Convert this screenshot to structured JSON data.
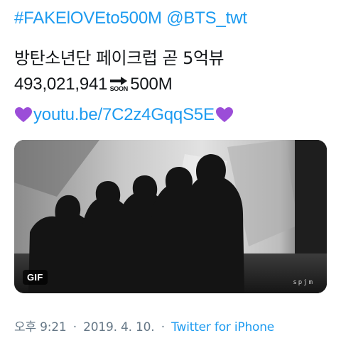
{
  "tweet": {
    "hashtag": "#FAKElOVEto500M",
    "mention": "@BTS_twt",
    "korean_line": "방탄소년단 페이크럽 곧 5억뷰",
    "count_before": "493,021,941",
    "soon_label": "SOON",
    "count_after": "500M",
    "link": "youtu.be/7C2z4GqqS5E",
    "heart_color": "#9b4dd8"
  },
  "media": {
    "badge": "GIF",
    "watermark": "spjm"
  },
  "meta": {
    "time": "오후 9:21",
    "separator1": "·",
    "date": "2019. 4. 10.",
    "separator2": "·",
    "source": "Twitter for iPhone"
  }
}
